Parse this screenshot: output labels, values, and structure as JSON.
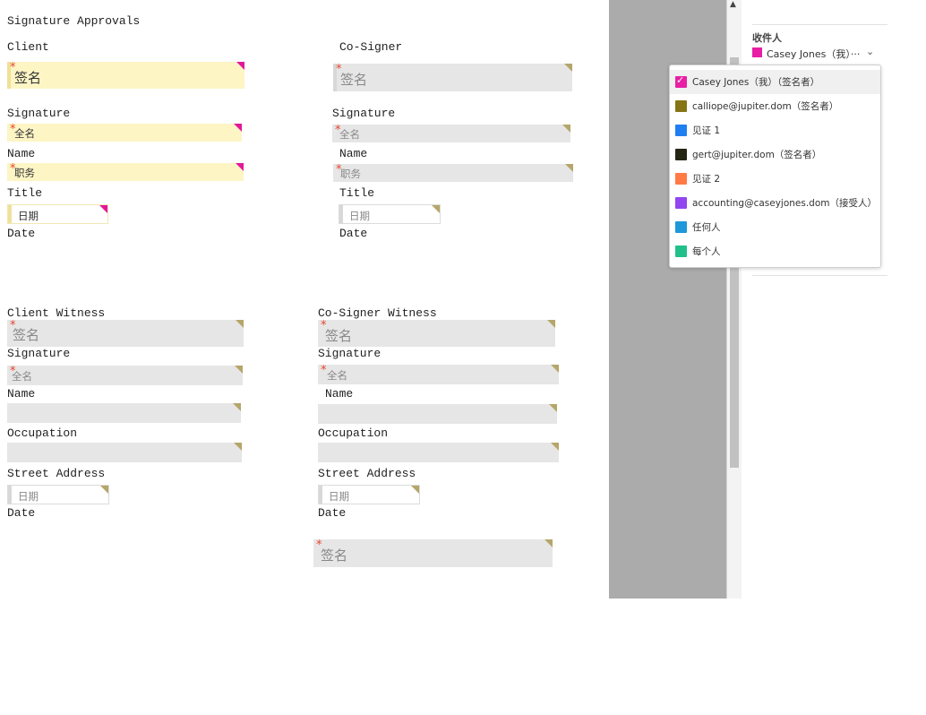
{
  "document": {
    "heading": "Signature Approvals",
    "client": {
      "title": "Client",
      "signature_label": "Signature",
      "name_label": "Name",
      "title_label": "Title",
      "date_label": "Date"
    },
    "cosigner": {
      "title": "Co-Signer",
      "signature_label": "Signature",
      "name_label": "Name",
      "title_label": "Title",
      "date_label": "Date"
    },
    "client_witness": {
      "title": "Client Witness",
      "signature_label": "Signature",
      "name_label": "Name",
      "occupation_label": "Occupation",
      "address_label": "Street Address",
      "date_label": "Date"
    },
    "cosigner_witness": {
      "title": "Co-Signer Witness",
      "signature_label": "Signature",
      "name_label": "Name",
      "occupation_label": "Occupation",
      "address_label": "Street Address",
      "date_label": "Date"
    },
    "placeholders": {
      "signature": "签名",
      "full_name": "全名",
      "job_title": "职务",
      "date": "日期"
    },
    "required_mark": "*"
  },
  "scrollbar": {
    "up_arrow": "▲"
  },
  "recipient_panel": {
    "title": "收件人",
    "selected": "Casey Jones（我）···",
    "selected_color": "#e81ea5",
    "chevron": "⌄"
  },
  "recipient_dropdown": {
    "items": [
      {
        "label": "Casey Jones（我）（签名者）",
        "color": "#e81ea5",
        "checked": true
      },
      {
        "label": "calliope@jupiter.dom（签名者）",
        "color": "#857515",
        "checked": false
      },
      {
        "label": "见证 1",
        "color": "#1f7ff0",
        "checked": false
      },
      {
        "label": "gert@jupiter.dom（签名者）",
        "color": "#252513",
        "checked": false
      },
      {
        "label": "见证 2",
        "color": "#ff7a45",
        "checked": false
      },
      {
        "label": "accounting@caseyjones.dom（接受人）",
        "color": "#9146f0",
        "checked": false
      },
      {
        "label": "任何人",
        "color": "#1e98d8",
        "checked": false
      },
      {
        "label": "每个人",
        "color": "#21c08a",
        "checked": false
      }
    ],
    "check_glyph": "✓"
  }
}
